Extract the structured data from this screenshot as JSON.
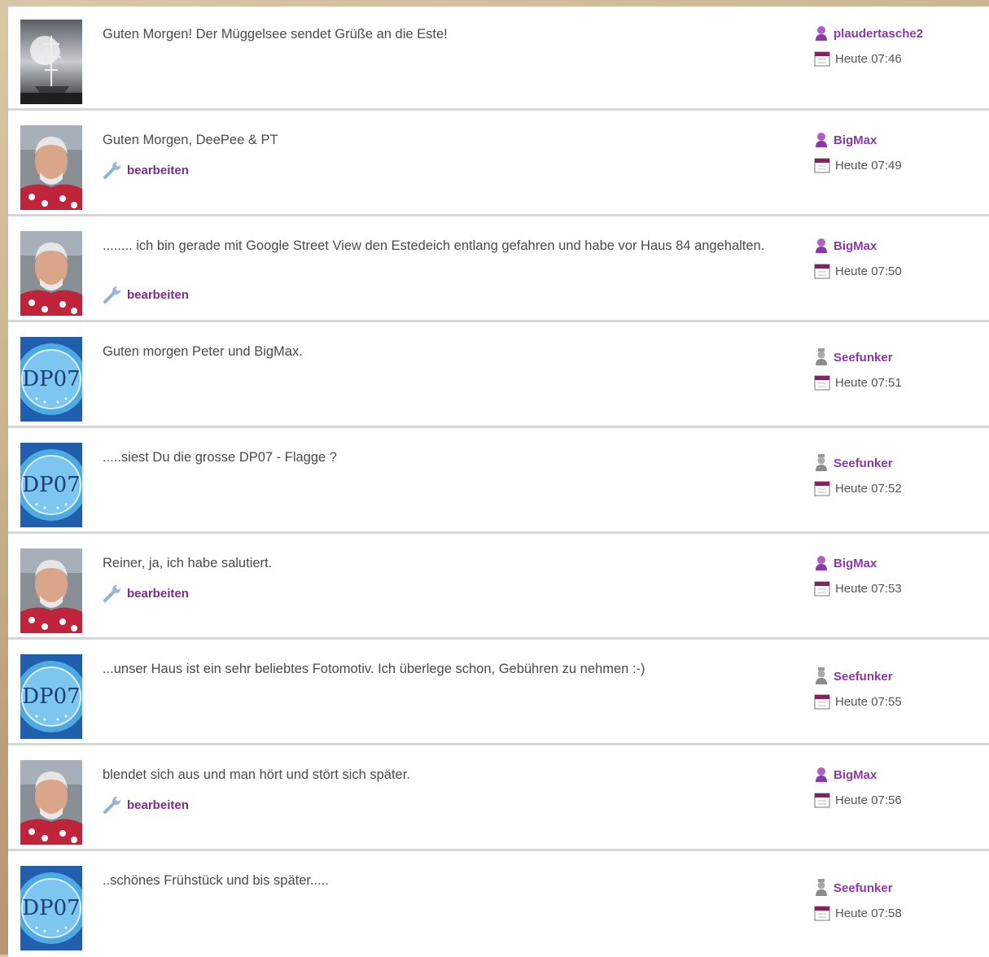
{
  "posts": [
    {
      "text": "Guten Morgen! Der Müggelsee sendet Grüße an die Este!",
      "user": "plaudertasche2",
      "time": "Heute 07:46",
      "edit": ""
    },
    {
      "text": "Guten Morgen, DeePee & PT",
      "user": "BigMax",
      "time": "Heute 07:49",
      "edit": "bearbeiten"
    },
    {
      "text": "........ ich bin gerade mit Google Street View den Estedeich entlang gefahren und habe vor Haus 84 angehalten.",
      "user": "BigMax",
      "time": "Heute 07:50",
      "edit": "bearbeiten"
    },
    {
      "text": "Guten morgen Peter und BigMax.",
      "user": "Seefunker",
      "time": "Heute 07:51",
      "edit": ""
    },
    {
      "text": ".....siest Du die grosse DP07 - Flagge ?",
      "user": "Seefunker",
      "time": "Heute 07:52",
      "edit": ""
    },
    {
      "text": "Reiner, ja, ich habe salutiert.",
      "user": "BigMax",
      "time": "Heute 07:53",
      "edit": "bearbeiten"
    },
    {
      "text": "...unser Haus ist ein sehr beliebtes Fotomotiv. Ich überlege schon, Gebühren zu nehmen :-)",
      "user": "Seefunker",
      "time": "Heute 07:55",
      "edit": ""
    },
    {
      "text": "blendet sich aus und man hört und stört sich später.",
      "user": "BigMax",
      "time": "Heute 07:56",
      "edit": "bearbeiten"
    },
    {
      "text": "..schönes Frühstück und bis später.....",
      "user": "Seefunker",
      "time": "Heute 07:58",
      "edit": ""
    }
  ],
  "avatar_logo_text": "DP07",
  "colors": {
    "username": "#8a3aa5",
    "edit_link": "#7b2c8f",
    "text": "#4a4a4a",
    "divider": "#d6d6d6"
  }
}
